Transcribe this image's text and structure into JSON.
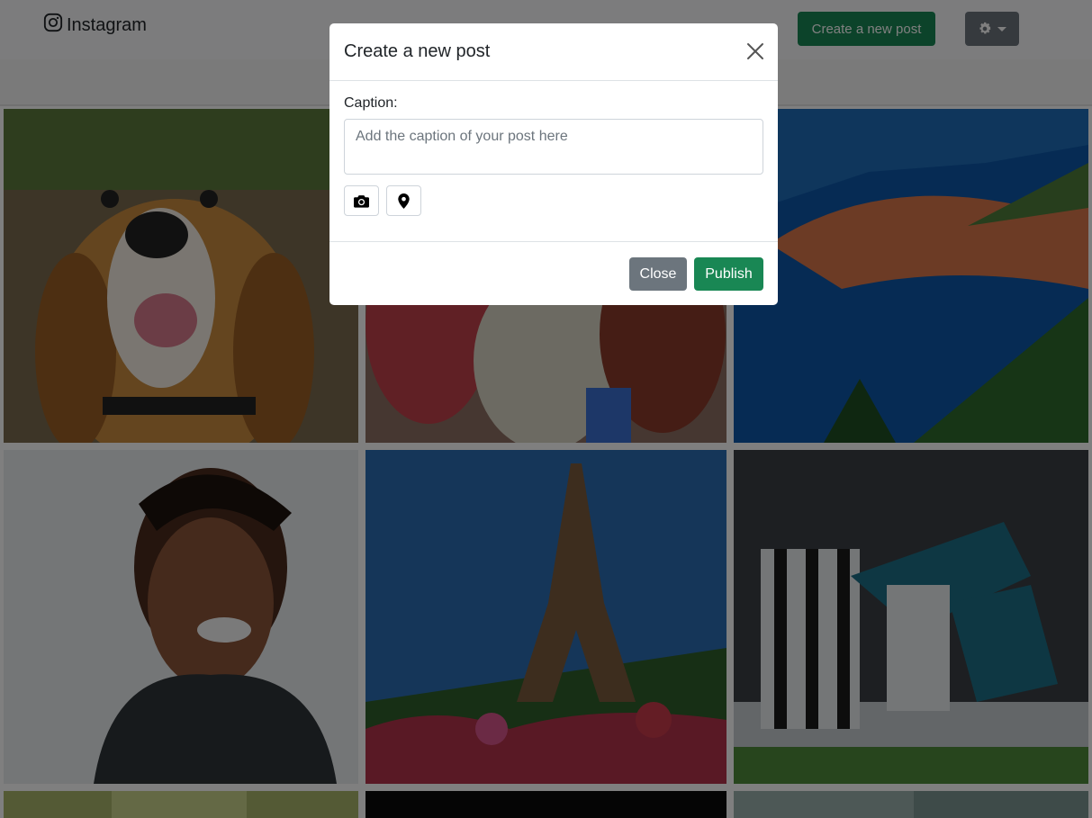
{
  "navbar": {
    "brand": "Instagram",
    "create_button": "Create a new post",
    "settings_icon": "gear-icon"
  },
  "grid": {
    "photos": [
      {
        "subject": "beagle dog"
      },
      {
        "subject": "group of friends"
      },
      {
        "subject": "coastal old town"
      },
      {
        "subject": "smiling woman"
      },
      {
        "subject": "eiffel tower"
      },
      {
        "subject": "football match"
      }
    ]
  },
  "modal": {
    "title": "Create a new post",
    "caption_label": "Caption:",
    "caption_placeholder": "Add the caption of your post here",
    "caption_value": "",
    "camera_icon": "camera-icon",
    "location_icon": "map-pin-icon",
    "close_label": "Close",
    "publish_label": "Publish"
  },
  "colors": {
    "success": "#198754",
    "secondary": "#6c757d"
  }
}
